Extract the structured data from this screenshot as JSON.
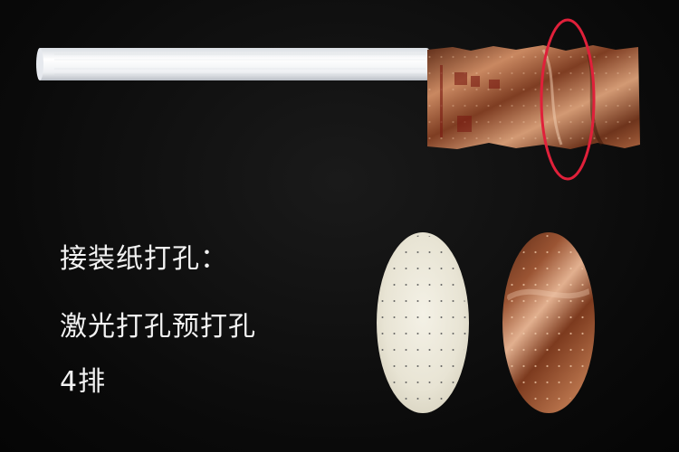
{
  "caption": {
    "line1": "接装纸打孔：",
    "line2": "激光打孔预打孔",
    "line3": "4排"
  },
  "colors": {
    "background": "#0b0b0b",
    "cigarette_paper": "#f3f4f6",
    "tipping_paper": "#a8623e",
    "highlight_circle": "#e0203a",
    "caption_text": "#f2f2f2"
  },
  "perforation_rows": 4
}
